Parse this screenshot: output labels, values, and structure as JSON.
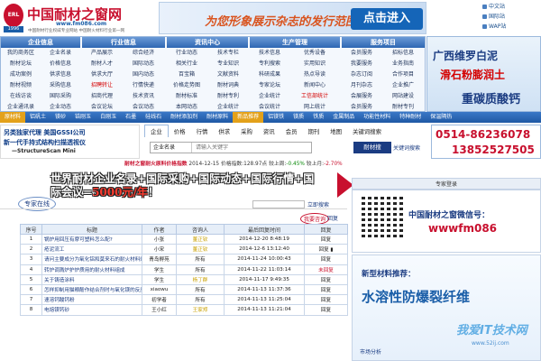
{
  "header": {
    "logo_mark": "ERL",
    "logo_year": "1996",
    "site_name": "中国耐材之窗网",
    "site_url": "www.fm086.com",
    "slogan": "中国耐材行业权威专业网站 中国耐火材料行业第一网",
    "banner_text": "为您形象展示杂志的发行范围",
    "banner_button": "点击进入",
    "top_links": [
      "中文站",
      "国际站",
      "WAP站"
    ]
  },
  "nav": {
    "heads": [
      "企业信息",
      "行业信息",
      "资讯中心",
      "生产管理",
      "服务项目"
    ],
    "columns": [
      [
        "我的商务区",
        "耐材论坛",
        "成功案例",
        "耐材视频",
        "在线访谈",
        "企业通讯录"
      ],
      [
        "企业名录",
        "价格信息",
        "供求信息",
        "采购信息",
        "国际采购",
        "企业动态"
      ],
      [
        "产品展示",
        "耐材人才",
        "供求大厅",
        "招聘转让",
        "招商代理",
        "会议论坛"
      ],
      [
        "综合经济",
        "国际动态",
        "国内动态",
        "行情快递",
        "技术资讯",
        "会议动态"
      ],
      [
        "行业动态",
        "相关行业",
        "百宝箱",
        "价格走势图",
        "耐材标准",
        "本网动态"
      ],
      [
        "技术专栏",
        "专业知识",
        "文献资料",
        "耐材词典",
        "耐材专利",
        "企业统计"
      ],
      [
        "技术信息",
        "专利搜索",
        "科研成果",
        "专家论坛",
        "企业统计",
        "会议统计"
      ],
      [
        "优秀设备",
        "实用知识",
        "热点导读",
        "新闻中心",
        "工信部统计",
        "网上统计"
      ],
      [
        "会员服务",
        "我要服务",
        "杂志订阅",
        "月刊杂志",
        "会展服务",
        "会员服务"
      ],
      [
        "招标信息",
        "业务指南",
        "合作项目",
        "企业推广",
        "网站建设",
        "耐材专刊"
      ]
    ]
  },
  "ad_right": {
    "line1": "广西维罗白泥",
    "line2": "滑石粉膨润土",
    "line3": "重碳质酸钙"
  },
  "categories": [
    "原材料",
    "铝矾土",
    "镁砂",
    "锆刚玉",
    "白刚玉",
    "石墨",
    "硅线石",
    "耐材添加剂",
    "耐材原料",
    "新品推荐",
    "铝镁铁",
    "镁质",
    "铁质",
    "金属制品",
    "功能性材料",
    "特种耐材",
    "保温隔热"
  ],
  "gss": {
    "line1": "另类独家代理 美国GSSI公司",
    "line2": "新一代手持式结构扫描透视仪",
    "line3": "—StructureScan Mini"
  },
  "search": {
    "tabs": [
      "企业",
      "价格",
      "行情",
      "供求",
      "采购",
      "资讯",
      "会员",
      "期刊",
      "地图",
      "关键词搜索"
    ],
    "select_value": "企业名录",
    "placeholder": "请输入关键字",
    "button": "耐材搜",
    "hot_label": "关键词搜索"
  },
  "phone": {
    "line1": "0514-86236078",
    "line2": "13852527505"
  },
  "index_bar": {
    "name": "耐材之窗耐火原料价格指数",
    "date": "2014-12-15",
    "price_label": "价格指数:",
    "price": "128.97点",
    "week_label": "较上周:",
    "week": "-0.45%",
    "month_label": "较上月:",
    "month": "-2.70%"
  },
  "big_banner": {
    "line1": "世界耐材企业名录+国际采购+国际动态+国际行情+国",
    "line2_pre": "际会议=",
    "line2_hl": "5000元/年",
    "line2_post": "！"
  },
  "expert": {
    "tab": "专家在线",
    "search_button": "立即搜索",
    "ask_link": "我要咨询",
    "history_link": "回复",
    "columns": [
      "序号",
      "标题",
      "作者",
      "咨询人",
      "最后回复时间",
      "回复"
    ],
    "rows": [
      [
        "1",
        "锅炉用回压有摩可塑料怎么配?",
        "小张",
        "董正钦",
        "2014-12-20 8:48:19",
        "回复"
      ],
      [
        "2",
        "疮泥流工",
        "小宋",
        "董正钦",
        "2014-12-6 13:12:40",
        "回复 ▮"
      ],
      [
        "3",
        "请问主要成分为氧化铝和莫来石的耐火材料烧制成...",
        "青岛孵苑",
        "所有",
        "2014-11-24 10:00:43",
        "回复"
      ],
      [
        "4",
        "转炉调溅炉护炉质用的耐火材料组成",
        "学生",
        "所有",
        "2014-11-22 11:03:14",
        "未回复"
      ],
      [
        "5",
        "关于铸造涂料",
        "学生",
        "杨丁群",
        "2014-11-17 9:49:35",
        "回复"
      ],
      [
        "6",
        "怎样抑制用猫粮酚作结合剂时与氧化镁的反应",
        "xiaowu",
        "所有",
        "2014-11-13 11:37:36",
        "回复"
      ],
      [
        "7",
        "速溶钙酸钙粉",
        "初学者",
        "所有",
        "2014-11-13 11:25:04",
        "回复"
      ],
      [
        "8",
        "电熔镁钙砂",
        "王小红",
        "王家郑",
        "2014-11-13 11:21:04",
        "回复"
      ]
    ]
  },
  "sidebar": {
    "expert_login": "专家登录",
    "wechat_title": "中国耐材之窗微信号：",
    "wechat_id": "wwwfm086",
    "new_mat_title": "新型材料推荐：",
    "new_mat_big": "水溶性防爆裂纤维",
    "market_link": "市场分析"
  },
  "watermark": {
    "text": "我爱IT技术网",
    "url": "www.52ij.com"
  }
}
